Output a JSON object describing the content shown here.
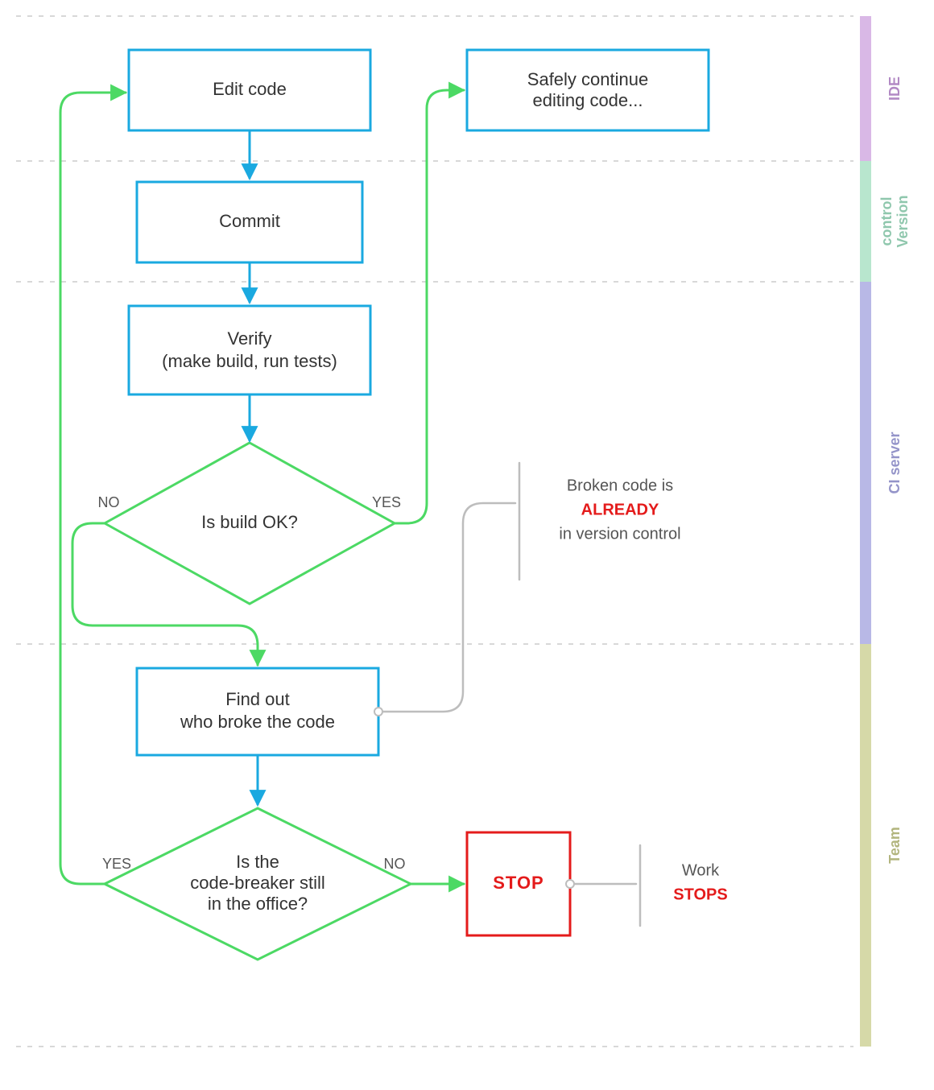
{
  "nodes": {
    "edit": "Edit code",
    "continue_l1": "Safely continue",
    "continue_l2": "editing code...",
    "commit": "Commit",
    "verify_l1": "Verify",
    "verify_l2": "(make build, run tests)",
    "build_ok": "Is build OK?",
    "find_l1": "Find out",
    "find_l2": "who broke the code",
    "office_l1": "Is the",
    "office_l2": "code-breaker still",
    "office_l3": "in the office?",
    "stop": "STOP"
  },
  "edges": {
    "yes": "YES",
    "no": "NO"
  },
  "notes": {
    "broken_l1": "Broken code is",
    "broken_l2": "ALREADY",
    "broken_l3": "in version control",
    "work_l1": "Work",
    "work_l2": "STOPS"
  },
  "lanes": {
    "ide": "IDE",
    "vcs": "Version\ncontrol",
    "ci": "CI server",
    "team": "Team"
  },
  "colors": {
    "blue": "#1aa9e0",
    "green": "#4cd964",
    "red": "#e41b1b",
    "grey": "#bdbdbd",
    "lane_ide": "#d9b8e6",
    "lane_vcs": "#b8e6ce",
    "lane_ci": "#b8b8e6",
    "lane_team": "#d6d9a8"
  }
}
